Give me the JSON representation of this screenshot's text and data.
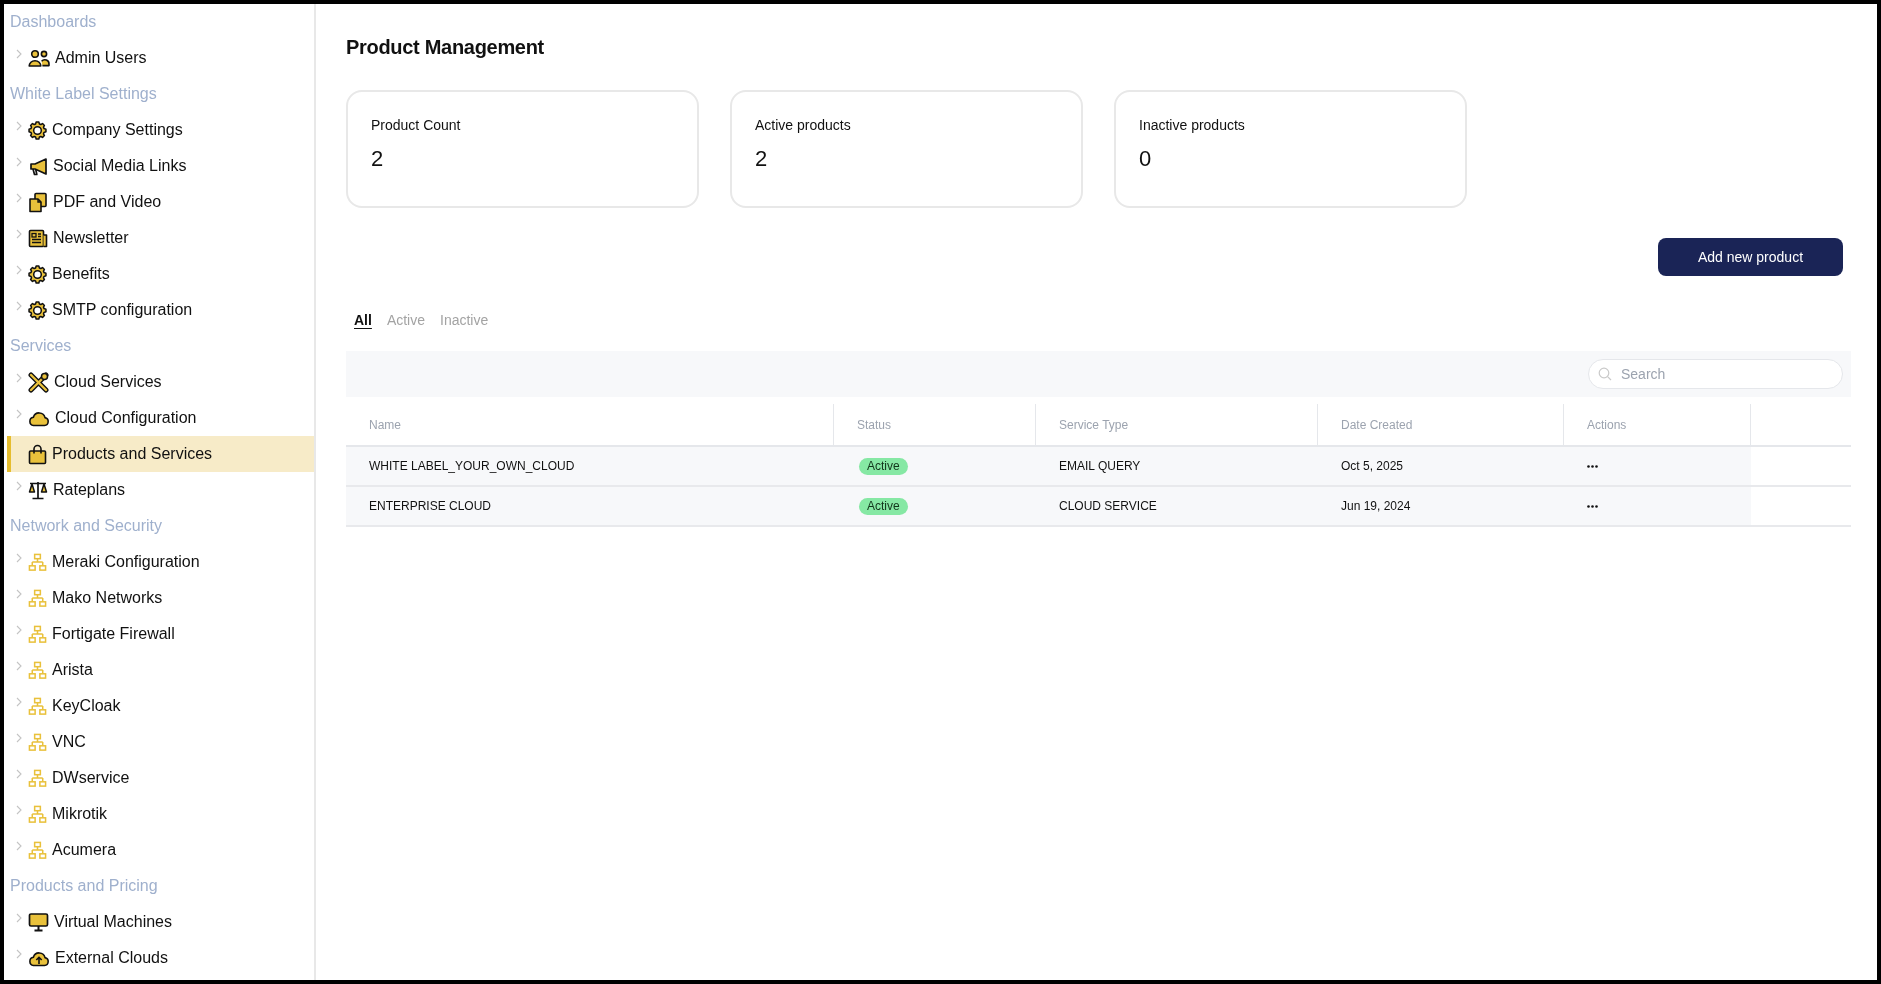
{
  "sidebar": {
    "sections": [
      {
        "title": "Dashboards",
        "items": [
          {
            "label": "Admin Users",
            "selected": false,
            "expanded": false
          }
        ]
      },
      {
        "title": "White Label Settings",
        "items": [
          {
            "label": "Company Settings",
            "selected": false,
            "expanded": false
          },
          {
            "label": "Social Media Links",
            "selected": false,
            "expanded": false
          },
          {
            "label": "PDF and Video",
            "selected": false,
            "expanded": false
          },
          {
            "label": "Newsletter",
            "selected": false,
            "expanded": false
          },
          {
            "label": "Benefits",
            "selected": false,
            "expanded": false
          },
          {
            "label": "SMTP configuration",
            "selected": false,
            "expanded": false
          }
        ]
      },
      {
        "title": "Services",
        "items": [
          {
            "label": "Cloud Services",
            "selected": false,
            "expanded": false
          },
          {
            "label": "Cloud Configuration",
            "selected": false,
            "expanded": false
          },
          {
            "label": "Products and Services",
            "selected": true
          },
          {
            "label": "Rateplans",
            "selected": false,
            "expanded": false
          }
        ]
      },
      {
        "title": "Network and Security",
        "items": [
          {
            "label": "Meraki Configuration",
            "selected": false,
            "expanded": false
          },
          {
            "label": "Mako Networks",
            "selected": false,
            "expanded": false
          },
          {
            "label": "Fortigate Firewall",
            "selected": false,
            "expanded": false
          },
          {
            "label": "Arista",
            "selected": false,
            "expanded": false
          },
          {
            "label": "KeyCloak",
            "selected": false,
            "expanded": false
          },
          {
            "label": "VNC",
            "selected": false,
            "expanded": false
          },
          {
            "label": "DWservice",
            "selected": false,
            "expanded": false
          },
          {
            "label": "Mikrotik",
            "selected": false,
            "expanded": false
          },
          {
            "label": "Acumera",
            "selected": false,
            "expanded": false
          }
        ]
      },
      {
        "title": "Products and Pricing",
        "items": [
          {
            "label": "Virtual Machines",
            "selected": false,
            "expanded": false
          },
          {
            "label": "External Clouds",
            "selected": false,
            "expanded": false
          }
        ]
      }
    ]
  },
  "page": {
    "title": "Product Management"
  },
  "stats": [
    {
      "label": "Product Count",
      "value": "2"
    },
    {
      "label": "Active products",
      "value": "2"
    },
    {
      "label": "Inactive products",
      "value": "0"
    }
  ],
  "add_button": {
    "label": "Add new product"
  },
  "filter_tabs": [
    {
      "label": "All",
      "selected": true
    },
    {
      "label": "Active",
      "selected": false
    },
    {
      "label": "Inactive",
      "selected": false
    }
  ],
  "search": {
    "placeholder": "Search"
  },
  "table": {
    "columns": [
      "Name",
      "Status",
      "Service Type",
      "Date Created",
      "Actions"
    ],
    "rows": [
      {
        "name": "WHITE LABEL_YOUR_OWN_CLOUD",
        "status": "Active",
        "service_type": "EMAIL QUERY",
        "date_created": "Oct 5, 2025"
      },
      {
        "name": "ENTERPRISE CLOUD",
        "status": "Active",
        "service_type": "CLOUD SERVICE",
        "date_created": "Jun 19, 2024"
      }
    ]
  }
}
